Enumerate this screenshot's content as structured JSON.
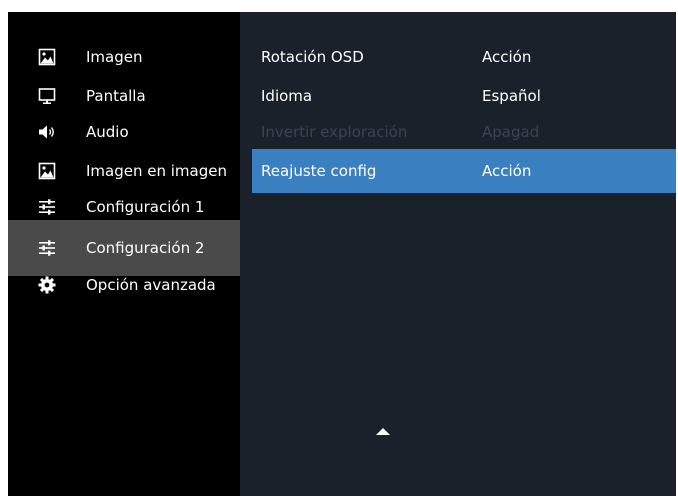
{
  "sidebar": {
    "items": [
      {
        "label": "Imagen",
        "icon": "picture-icon"
      },
      {
        "label": "Pantalla",
        "icon": "monitor-icon"
      },
      {
        "label": "Audio",
        "icon": "speaker-icon"
      },
      {
        "label": "Imagen en imagen",
        "icon": "picture-in-picture-icon"
      },
      {
        "label": "Configuración 1",
        "icon": "sliders-icon"
      },
      {
        "label": "Configuración 2",
        "icon": "sliders-icon",
        "selected": true
      },
      {
        "label": "Opción avanzada",
        "icon": "gear-icon"
      }
    ]
  },
  "settings": {
    "rows": [
      {
        "name": "Rotación OSD",
        "value": "Acción"
      },
      {
        "name": "Idioma",
        "value": "Español"
      },
      {
        "name": "Invertir exploración",
        "value": "Apagad",
        "disabled": true
      },
      {
        "name": "Reajuste config",
        "value": "Acción",
        "selected": true
      }
    ]
  },
  "colors": {
    "sidebar_bg": "#000000",
    "sidebar_selected": "#4a4a4a",
    "content_bg": "#1a212b",
    "highlight": "#3a7fc0",
    "disabled_text": "#3a4452",
    "text": "#ffffff"
  }
}
